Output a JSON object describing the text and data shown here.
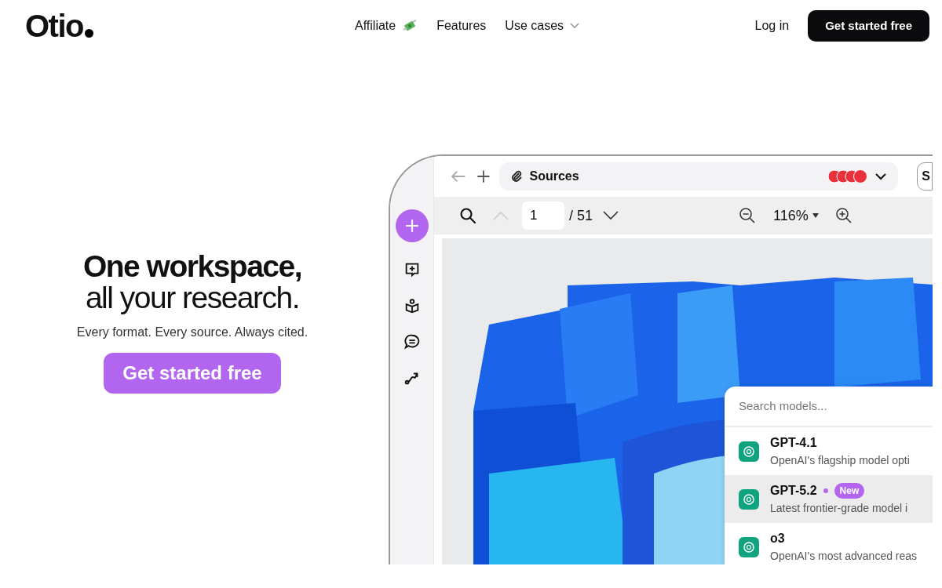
{
  "nav": {
    "logo": "Otio",
    "links": [
      {
        "label": "Affiliate",
        "icon": true,
        "dropdown": false
      },
      {
        "label": "Features",
        "icon": false,
        "dropdown": false
      },
      {
        "label": "Use cases",
        "icon": false,
        "dropdown": true
      }
    ],
    "login": "Log in",
    "cta": "Get started free"
  },
  "hero": {
    "title_lines": [
      "One workspace,",
      "all your research."
    ],
    "subtitle": "Every format. Every source. Always cited.",
    "cta": "Get started free"
  },
  "preview": {
    "tab_label": "Sources",
    "side_button": "S",
    "page": "1",
    "page_total": "/ 51",
    "zoom": "116%",
    "models": {
      "placeholder": "Search models...",
      "items": [
        {
          "name": "GPT-4.1",
          "description": "OpenAI's flagship model opti",
          "selected": false
        },
        {
          "name": "GPT-5.2",
          "badge": "New",
          "description": "Latest frontier-grade model i",
          "selected": true
        },
        {
          "name": "o3",
          "description": "OpenAI's most advanced reas",
          "selected": false
        }
      ]
    }
  }
}
